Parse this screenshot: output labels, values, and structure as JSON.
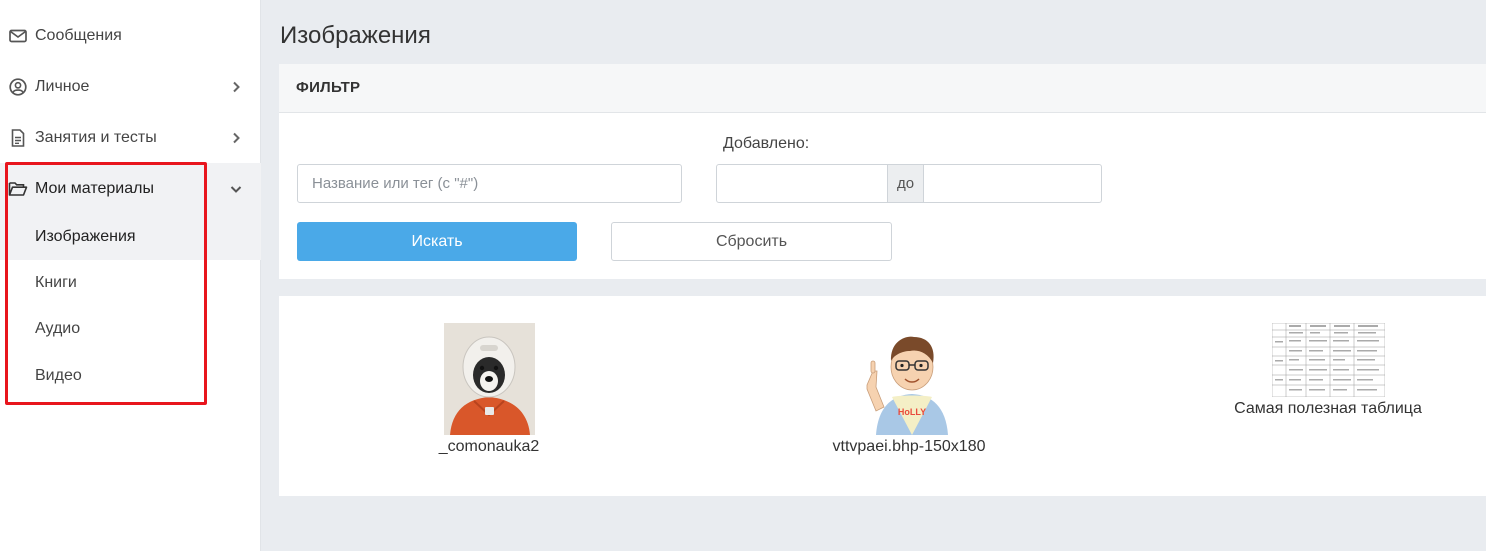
{
  "sidebar": {
    "items": [
      {
        "label": "Сообщения",
        "icon": "envelope-icon",
        "has_chevron": false
      },
      {
        "label": "Личное",
        "icon": "user-circle-icon",
        "has_chevron": true
      },
      {
        "label": "Занятия и тесты",
        "icon": "document-icon",
        "has_chevron": true
      },
      {
        "label": "Мои материалы",
        "icon": "folder-open-icon",
        "has_chevron": true,
        "expanded": true
      }
    ],
    "submenu": [
      {
        "label": "Изображения",
        "active": true
      },
      {
        "label": "Книги"
      },
      {
        "label": "Аудио"
      },
      {
        "label": "Видео"
      }
    ],
    "highlight_color": "#e8151d"
  },
  "main": {
    "title": "Изображения",
    "filter": {
      "header": "ФИЛЬТР",
      "search_placeholder": "Название или тег (с \"#\")",
      "search_value": "",
      "added_label": "Добавлено:",
      "date_from_value": "",
      "date_separator": "до",
      "date_to_value": "",
      "search_button": "Искать",
      "reset_button": "Сбросить"
    },
    "images": [
      {
        "name": "_comonauka2",
        "thumb": "dog-astronaut-thumbnail"
      },
      {
        "name": "vttvpaei.bhp-150x180",
        "thumb": "cartoon-boy-thumbnail"
      },
      {
        "name": "Самая полезная таблица",
        "thumb": "table-document-thumbnail"
      }
    ]
  },
  "colors": {
    "accent": "#4aa9e8",
    "background": "#e9ecf0",
    "highlight": "#e8151d"
  }
}
